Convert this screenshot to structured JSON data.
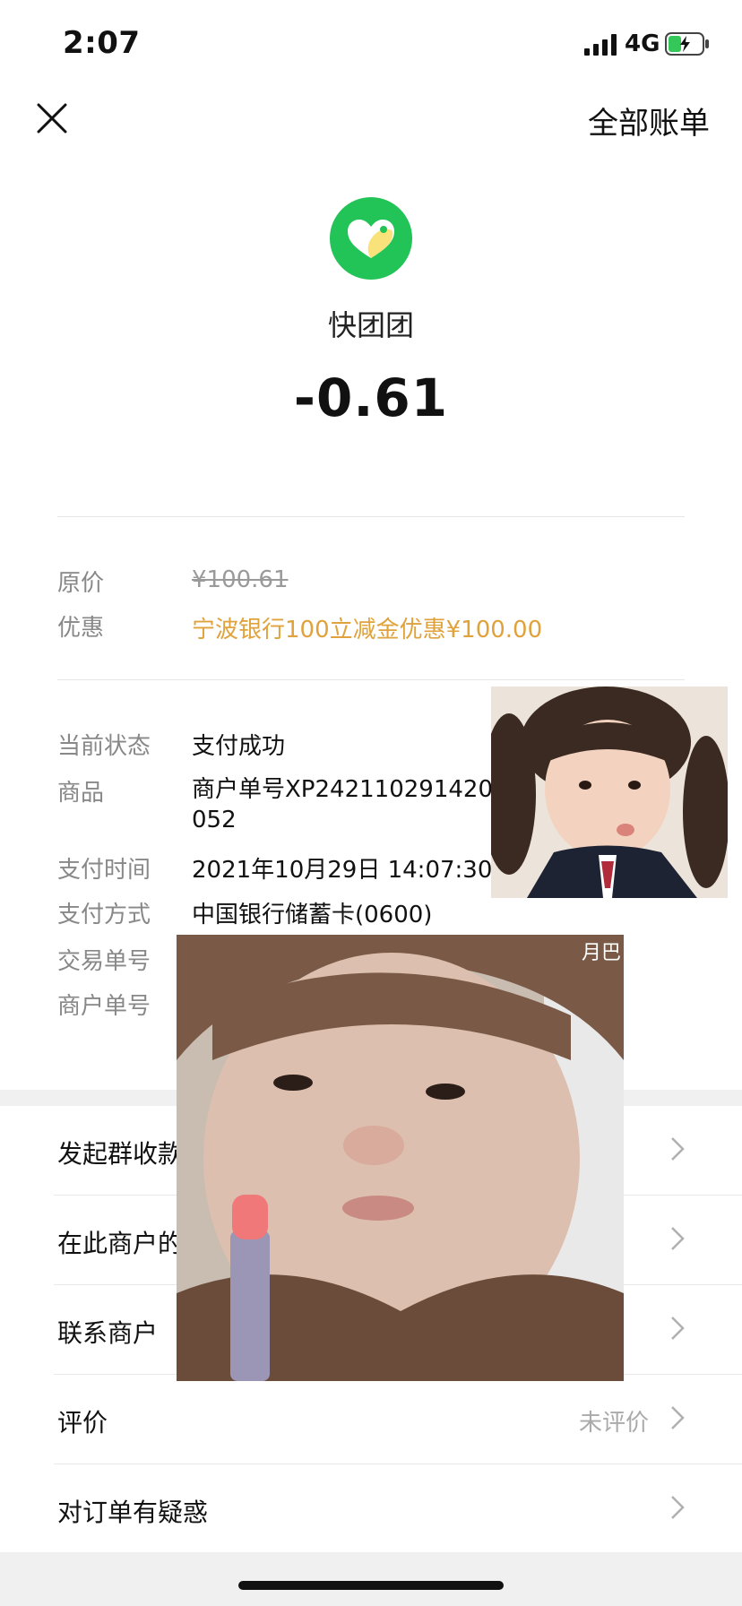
{
  "status_bar": {
    "time": "2:07",
    "network": "4G"
  },
  "header": {
    "close_icon": "close-icon",
    "all_bills": "全部账单"
  },
  "merchant": {
    "name": "快团团",
    "amount": "-0.61",
    "logo_color": "#22c357",
    "logo_heart_color": "#f9e27a"
  },
  "price_info": [
    {
      "label": "原价",
      "value": "¥100.61"
    },
    {
      "label": "优惠",
      "value": "宁波银行100立减金优惠¥100.00"
    }
  ],
  "details": [
    {
      "label": "当前状态",
      "value": "支付成功"
    },
    {
      "label": "商品",
      "value": "商户单号XP242110291420052"
    },
    {
      "label": "支付时间",
      "value": "2021年10月29日 14:07:30"
    },
    {
      "label": "支付方式",
      "value": "中国银行储蓄卡(0600)"
    },
    {
      "label": "交易单号",
      "value": ""
    },
    {
      "label": "商户单号",
      "value": ""
    }
  ],
  "overlay_text": "月巴",
  "menu": [
    {
      "label": "发起群收款",
      "sub": ""
    },
    {
      "label": "在此商户的",
      "sub": ""
    },
    {
      "label": "联系商户",
      "sub": ""
    },
    {
      "label": "评价",
      "sub": "未评价"
    },
    {
      "label": "对订单有疑惑",
      "sub": ""
    }
  ],
  "colors": {
    "discount": "#e0a23c",
    "brand_green": "#22c357"
  }
}
